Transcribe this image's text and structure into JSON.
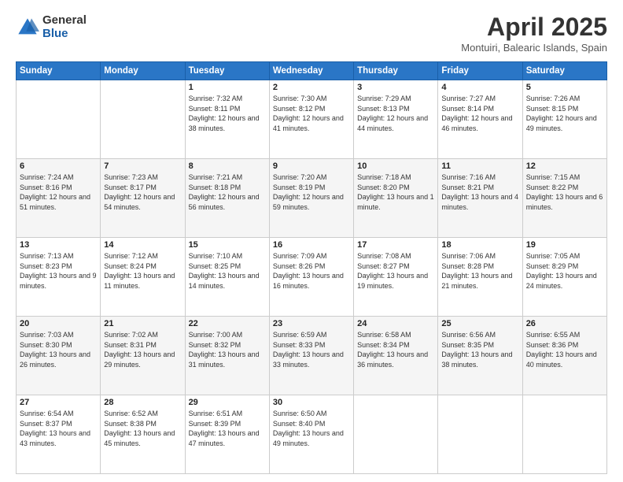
{
  "logo": {
    "general": "General",
    "blue": "Blue"
  },
  "header": {
    "month": "April 2025",
    "location": "Montuiri, Balearic Islands, Spain"
  },
  "weekdays": [
    "Sunday",
    "Monday",
    "Tuesday",
    "Wednesday",
    "Thursday",
    "Friday",
    "Saturday"
  ],
  "weeks": [
    [
      {
        "day": "",
        "sunrise": "",
        "sunset": "",
        "daylight": ""
      },
      {
        "day": "",
        "sunrise": "",
        "sunset": "",
        "daylight": ""
      },
      {
        "day": "1",
        "sunrise": "Sunrise: 7:32 AM",
        "sunset": "Sunset: 8:11 PM",
        "daylight": "Daylight: 12 hours and 38 minutes."
      },
      {
        "day": "2",
        "sunrise": "Sunrise: 7:30 AM",
        "sunset": "Sunset: 8:12 PM",
        "daylight": "Daylight: 12 hours and 41 minutes."
      },
      {
        "day": "3",
        "sunrise": "Sunrise: 7:29 AM",
        "sunset": "Sunset: 8:13 PM",
        "daylight": "Daylight: 12 hours and 44 minutes."
      },
      {
        "day": "4",
        "sunrise": "Sunrise: 7:27 AM",
        "sunset": "Sunset: 8:14 PM",
        "daylight": "Daylight: 12 hours and 46 minutes."
      },
      {
        "day": "5",
        "sunrise": "Sunrise: 7:26 AM",
        "sunset": "Sunset: 8:15 PM",
        "daylight": "Daylight: 12 hours and 49 minutes."
      }
    ],
    [
      {
        "day": "6",
        "sunrise": "Sunrise: 7:24 AM",
        "sunset": "Sunset: 8:16 PM",
        "daylight": "Daylight: 12 hours and 51 minutes."
      },
      {
        "day": "7",
        "sunrise": "Sunrise: 7:23 AM",
        "sunset": "Sunset: 8:17 PM",
        "daylight": "Daylight: 12 hours and 54 minutes."
      },
      {
        "day": "8",
        "sunrise": "Sunrise: 7:21 AM",
        "sunset": "Sunset: 8:18 PM",
        "daylight": "Daylight: 12 hours and 56 minutes."
      },
      {
        "day": "9",
        "sunrise": "Sunrise: 7:20 AM",
        "sunset": "Sunset: 8:19 PM",
        "daylight": "Daylight: 12 hours and 59 minutes."
      },
      {
        "day": "10",
        "sunrise": "Sunrise: 7:18 AM",
        "sunset": "Sunset: 8:20 PM",
        "daylight": "Daylight: 13 hours and 1 minute."
      },
      {
        "day": "11",
        "sunrise": "Sunrise: 7:16 AM",
        "sunset": "Sunset: 8:21 PM",
        "daylight": "Daylight: 13 hours and 4 minutes."
      },
      {
        "day": "12",
        "sunrise": "Sunrise: 7:15 AM",
        "sunset": "Sunset: 8:22 PM",
        "daylight": "Daylight: 13 hours and 6 minutes."
      }
    ],
    [
      {
        "day": "13",
        "sunrise": "Sunrise: 7:13 AM",
        "sunset": "Sunset: 8:23 PM",
        "daylight": "Daylight: 13 hours and 9 minutes."
      },
      {
        "day": "14",
        "sunrise": "Sunrise: 7:12 AM",
        "sunset": "Sunset: 8:24 PM",
        "daylight": "Daylight: 13 hours and 11 minutes."
      },
      {
        "day": "15",
        "sunrise": "Sunrise: 7:10 AM",
        "sunset": "Sunset: 8:25 PM",
        "daylight": "Daylight: 13 hours and 14 minutes."
      },
      {
        "day": "16",
        "sunrise": "Sunrise: 7:09 AM",
        "sunset": "Sunset: 8:26 PM",
        "daylight": "Daylight: 13 hours and 16 minutes."
      },
      {
        "day": "17",
        "sunrise": "Sunrise: 7:08 AM",
        "sunset": "Sunset: 8:27 PM",
        "daylight": "Daylight: 13 hours and 19 minutes."
      },
      {
        "day": "18",
        "sunrise": "Sunrise: 7:06 AM",
        "sunset": "Sunset: 8:28 PM",
        "daylight": "Daylight: 13 hours and 21 minutes."
      },
      {
        "day": "19",
        "sunrise": "Sunrise: 7:05 AM",
        "sunset": "Sunset: 8:29 PM",
        "daylight": "Daylight: 13 hours and 24 minutes."
      }
    ],
    [
      {
        "day": "20",
        "sunrise": "Sunrise: 7:03 AM",
        "sunset": "Sunset: 8:30 PM",
        "daylight": "Daylight: 13 hours and 26 minutes."
      },
      {
        "day": "21",
        "sunrise": "Sunrise: 7:02 AM",
        "sunset": "Sunset: 8:31 PM",
        "daylight": "Daylight: 13 hours and 29 minutes."
      },
      {
        "day": "22",
        "sunrise": "Sunrise: 7:00 AM",
        "sunset": "Sunset: 8:32 PM",
        "daylight": "Daylight: 13 hours and 31 minutes."
      },
      {
        "day": "23",
        "sunrise": "Sunrise: 6:59 AM",
        "sunset": "Sunset: 8:33 PM",
        "daylight": "Daylight: 13 hours and 33 minutes."
      },
      {
        "day": "24",
        "sunrise": "Sunrise: 6:58 AM",
        "sunset": "Sunset: 8:34 PM",
        "daylight": "Daylight: 13 hours and 36 minutes."
      },
      {
        "day": "25",
        "sunrise": "Sunrise: 6:56 AM",
        "sunset": "Sunset: 8:35 PM",
        "daylight": "Daylight: 13 hours and 38 minutes."
      },
      {
        "day": "26",
        "sunrise": "Sunrise: 6:55 AM",
        "sunset": "Sunset: 8:36 PM",
        "daylight": "Daylight: 13 hours and 40 minutes."
      }
    ],
    [
      {
        "day": "27",
        "sunrise": "Sunrise: 6:54 AM",
        "sunset": "Sunset: 8:37 PM",
        "daylight": "Daylight: 13 hours and 43 minutes."
      },
      {
        "day": "28",
        "sunrise": "Sunrise: 6:52 AM",
        "sunset": "Sunset: 8:38 PM",
        "daylight": "Daylight: 13 hours and 45 minutes."
      },
      {
        "day": "29",
        "sunrise": "Sunrise: 6:51 AM",
        "sunset": "Sunset: 8:39 PM",
        "daylight": "Daylight: 13 hours and 47 minutes."
      },
      {
        "day": "30",
        "sunrise": "Sunrise: 6:50 AM",
        "sunset": "Sunset: 8:40 PM",
        "daylight": "Daylight: 13 hours and 49 minutes."
      },
      {
        "day": "",
        "sunrise": "",
        "sunset": "",
        "daylight": ""
      },
      {
        "day": "",
        "sunrise": "",
        "sunset": "",
        "daylight": ""
      },
      {
        "day": "",
        "sunrise": "",
        "sunset": "",
        "daylight": ""
      }
    ]
  ]
}
